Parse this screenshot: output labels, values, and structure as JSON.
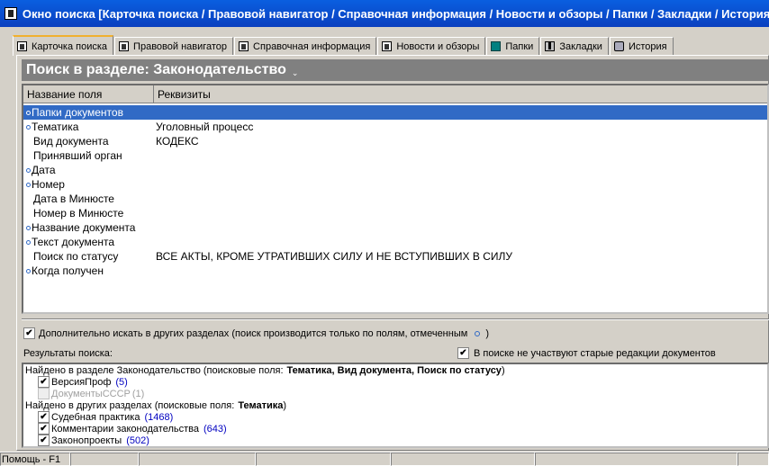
{
  "window": {
    "title": "Окно поиска [Карточка поиска / Правовой навигатор / Справочная информация / Новости и обзоры / Папки / Закладки / История]"
  },
  "tabs": [
    {
      "label": "Карточка поиска",
      "icon": "search-card-icon",
      "active": true
    },
    {
      "label": "Правовой навигатор",
      "icon": "navigator-doc-icon"
    },
    {
      "label": "Справочная информация",
      "icon": "reference-doc-icon"
    },
    {
      "label": "Новости и обзоры",
      "icon": "news-doc-icon"
    },
    {
      "label": "Папки",
      "icon": "folder-icon"
    },
    {
      "label": "Закладки",
      "icon": "bookmark-icon"
    },
    {
      "label": "История",
      "icon": "history-icon"
    }
  ],
  "section": {
    "title": "Поиск в разделе: Законодательство",
    "chevron": "⌄"
  },
  "grid": {
    "columns": [
      "Название поля",
      "Реквизиты"
    ],
    "rows": [
      {
        "name": "Папки документов",
        "value": "",
        "marked": true,
        "selected": true
      },
      {
        "name": "Тематика",
        "value": "Уголовный процесс",
        "marked": true
      },
      {
        "name": "Вид документа",
        "value": "КОДЕКС",
        "marked": false
      },
      {
        "name": "Принявший орган",
        "value": "",
        "marked": false
      },
      {
        "name": "Дата",
        "value": "",
        "marked": true
      },
      {
        "name": "Номер",
        "value": "",
        "marked": true
      },
      {
        "name": "Дата в Минюсте",
        "value": "",
        "marked": false
      },
      {
        "name": "Номер в Минюсте",
        "value": "",
        "marked": false
      },
      {
        "name": "Название документа",
        "value": "",
        "marked": true
      },
      {
        "name": "Текст документа",
        "value": "",
        "marked": true
      },
      {
        "name": "Поиск по статусу",
        "value": "ВСЕ АКТЫ, КРОМЕ УТРАТИВШИХ СИЛУ И НЕ ВСТУПИВШИХ В СИЛУ",
        "marked": false
      },
      {
        "name": "Когда получен",
        "value": "",
        "marked": true
      }
    ]
  },
  "extra_search": {
    "checked": true,
    "label": "Дополнительно искать в других разделах (поиск производится только по полям, отмеченным",
    "suffix": ")"
  },
  "results_label": "Результаты поиска:",
  "old_revisions": {
    "checked": true,
    "label": "В поиске не участвуют старые редакции документов"
  },
  "results": {
    "main_head": "Найдено в разделе Законодательство (поисковые поля:",
    "main_fields": "Тематика, Вид документа, Поиск по статусу",
    "main_close": ")",
    "main_items": [
      {
        "label": "ВерсияПроф",
        "count": "(5)",
        "checked": true,
        "disabled": false
      },
      {
        "label": "ДокументыСССР",
        "count": "(1)",
        "checked": false,
        "disabled": true
      }
    ],
    "other_head": "Найдено в других разделах (поисковые поля:",
    "other_fields": "Тематика",
    "other_close": ")",
    "other_items": [
      {
        "label": "Судебная практика",
        "count": "(1468)",
        "checked": true
      },
      {
        "label": "Комментарии законодательства",
        "count": "(643)",
        "checked": true
      },
      {
        "label": "Законопроекты",
        "count": "(502)",
        "checked": true
      }
    ]
  },
  "statusbar": {
    "help": "Помощь - F1"
  }
}
